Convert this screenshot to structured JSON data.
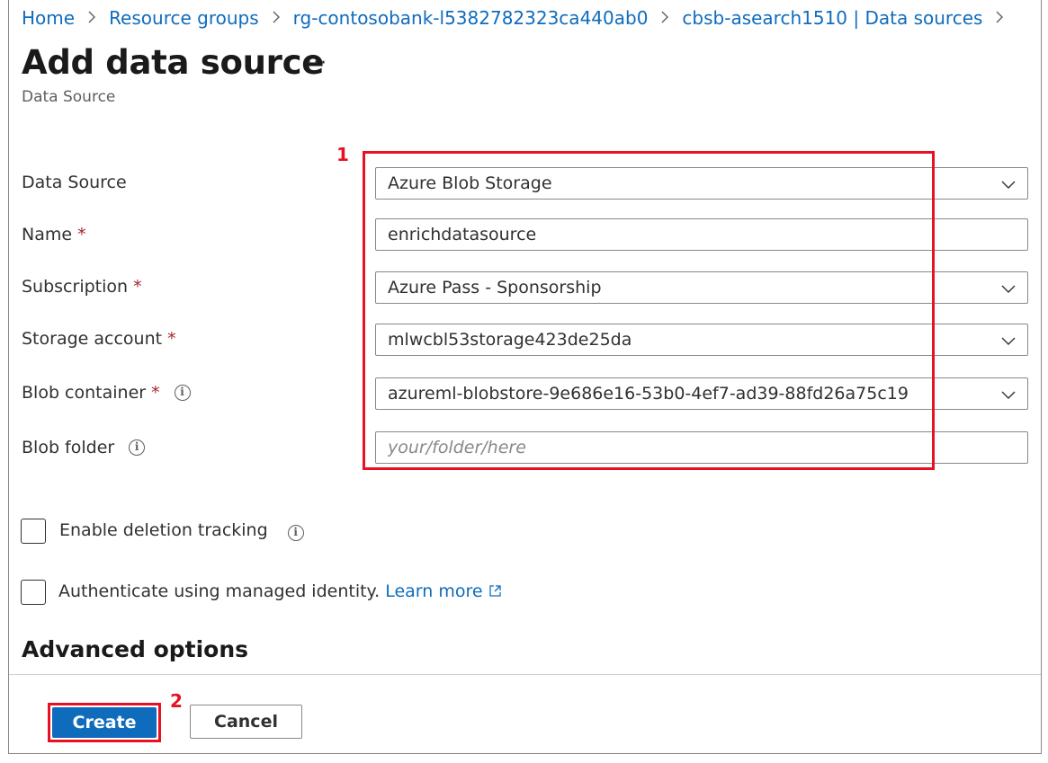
{
  "breadcrumb": {
    "items": [
      "Home",
      "Resource groups",
      "rg-contosobank-l5382782323ca440ab0",
      "cbsb-asearch1510 | Data sources"
    ],
    "separator": ">"
  },
  "page": {
    "title": "Add data source",
    "more_label": "···",
    "subtitle": "Data Source"
  },
  "form": {
    "required_marker": "*",
    "info_glyph": "i",
    "data_source": {
      "label": "Data Source",
      "value": "Azure Blob Storage"
    },
    "name": {
      "label": "Name",
      "value": "enrichdatasource"
    },
    "subscription": {
      "label": "Subscription",
      "value": "Azure Pass - Sponsorship"
    },
    "storage_account": {
      "label": "Storage account",
      "value": "mlwcbl53storage423de25da"
    },
    "blob_container": {
      "label": "Blob container",
      "value": "azureml-blobstore-9e686e16-53b0-4ef7-ad39-88fd26a75c19"
    },
    "blob_folder": {
      "label": "Blob folder",
      "value": "",
      "placeholder": "your/folder/here"
    }
  },
  "options": {
    "deletion_tracking": {
      "label": "Enable deletion tracking",
      "checked": false
    },
    "managed_identity": {
      "label": "Authenticate using managed identity.",
      "link": "Learn more",
      "checked": false
    }
  },
  "advanced": {
    "title": "Advanced options"
  },
  "actions": {
    "create_label": "Create",
    "cancel_label": "Cancel"
  },
  "annotations": {
    "marker_1": "1",
    "marker_2": "2"
  },
  "colors": {
    "accent": "#0f6cbd",
    "highlight": "#e81123",
    "required": "#a4262c"
  },
  "icons": [
    "chevron-right-icon",
    "more-icon",
    "chevron-down-icon",
    "info-icon",
    "external-link-icon"
  ]
}
